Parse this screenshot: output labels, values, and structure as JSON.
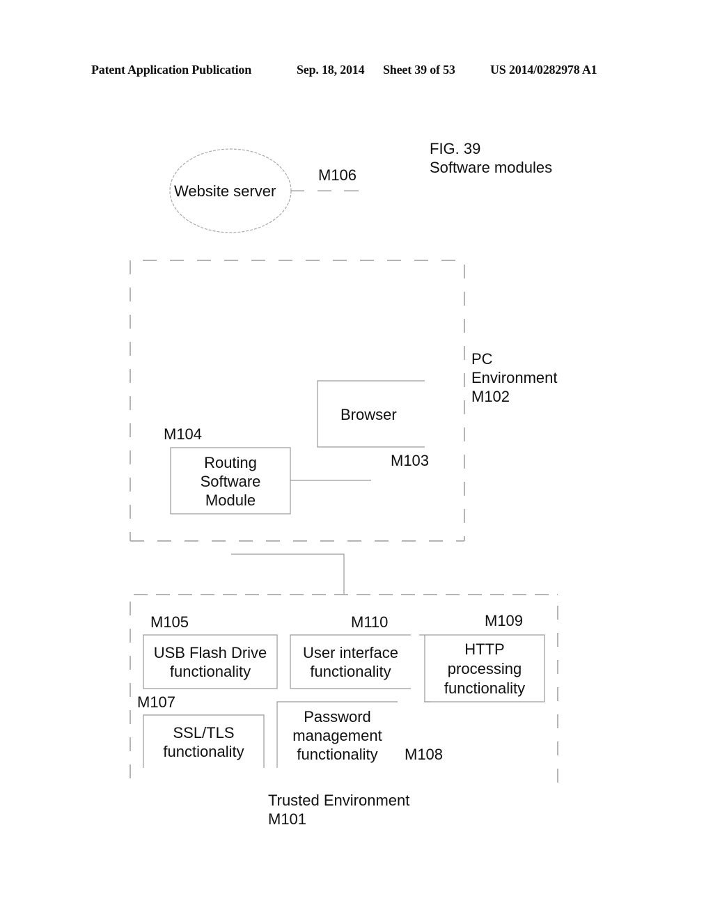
{
  "header": {
    "publication": "Patent Application Publication",
    "date": "Sep. 18, 2014",
    "sheet": "Sheet 39 of 53",
    "number": "US 2014/0282978 A1"
  },
  "figure": {
    "number": "FIG. 39",
    "title": "Software modules"
  },
  "nodes": {
    "website_server": {
      "label": "Website server",
      "ref": "M106"
    },
    "pc_environment": {
      "line1": "PC",
      "line2": "Environment",
      "ref": "M102"
    },
    "browser": {
      "label": "Browser",
      "ref": "M103"
    },
    "routing": {
      "line1": "Routing",
      "line2": "Software",
      "line3": "Module",
      "ref": "M104"
    },
    "trusted_environment": {
      "label": "Trusted Environment",
      "ref": "M101"
    },
    "usb": {
      "line1": "USB Flash Drive",
      "line2": "functionality",
      "ref": "M105"
    },
    "user_interface": {
      "line1": "User interface",
      "line2": "functionality",
      "ref": "M110"
    },
    "http": {
      "line1": "HTTP",
      "line2": "processing",
      "line3": "functionality",
      "ref": "M109"
    },
    "ssl": {
      "line1": "SSL/TLS",
      "line2": "functionality",
      "ref": "M107"
    },
    "password": {
      "line1": "Password",
      "line2": "management",
      "line3": "functionality",
      "ref": "M108"
    }
  },
  "colors": {
    "line": "#9a9a9a",
    "dash": "#b5b5b5",
    "text": "#111111"
  }
}
